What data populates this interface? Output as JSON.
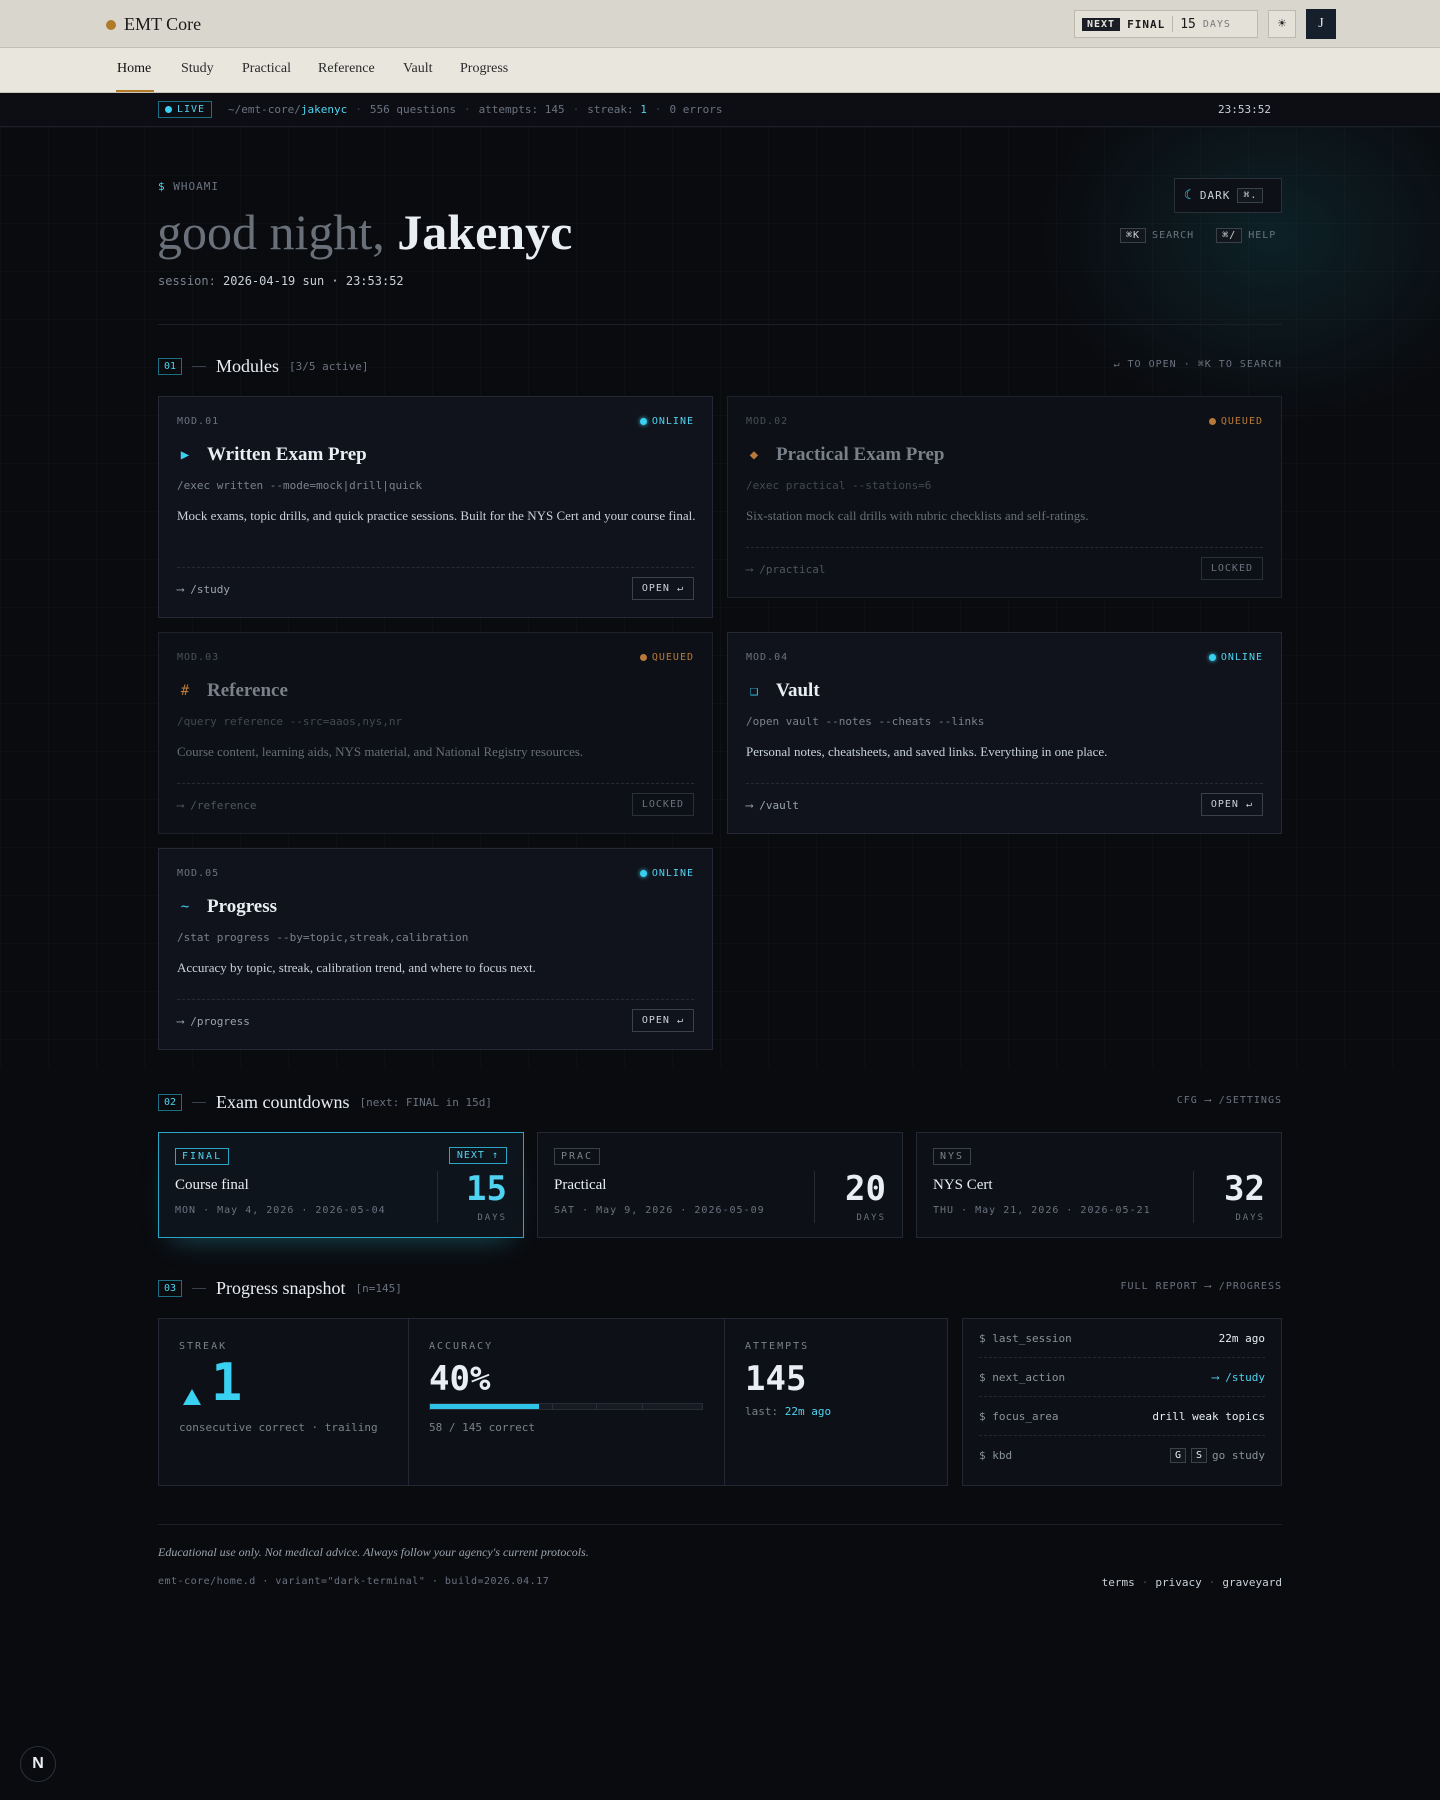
{
  "brand": {
    "name": "EMT Core"
  },
  "topbar": {
    "next_tag": "NEXT",
    "next_label": "FINAL",
    "next_days": "15",
    "next_unit": "DAYS",
    "theme_icon": "sun-icon",
    "avatar_initial": "J"
  },
  "nav": {
    "items": [
      {
        "label": "Home",
        "active": true
      },
      {
        "label": "Study"
      },
      {
        "label": "Practical"
      },
      {
        "label": "Reference"
      },
      {
        "label": "Vault"
      },
      {
        "label": "Progress"
      }
    ]
  },
  "status": {
    "live": "LIVE",
    "path_prefix": "~/emt-core/",
    "user": "jakenyc",
    "questions": "556 questions",
    "attempts": "attempts: 145",
    "streak_label": "streak: ",
    "streak_value": "1",
    "errors": "0 errors",
    "time": "23:53:52"
  },
  "hero": {
    "prompt_symbol": "$",
    "prompt": "WHOAMI",
    "greeting": "good night, ",
    "name": "Jakenyc",
    "session_label": "session: ",
    "session_value": "2026-04-19 sun · 23:53:52",
    "dark_label": "DARK",
    "dark_kbd": "⌘.",
    "search_kbd": "⌘K",
    "search_label": "SEARCH",
    "help_kbd": "⌘/",
    "help_label": "HELP"
  },
  "modules_section": {
    "num": "01",
    "title": "Modules",
    "meta": "[3/5 active]",
    "right": "↵ TO OPEN · ⌘K TO SEARCH",
    "cards": [
      {
        "id": "MOD.01",
        "state": "ONLINE",
        "icon": "▶",
        "title": "Written Exam Prep",
        "cmd": "/exec written --mode=mock|drill|quick",
        "desc": "Mock exams, topic drills, and quick practice sessions. Built for the NYS Cert and your course final.",
        "route": "⟶ /study",
        "action": "OPEN ↵"
      },
      {
        "id": "MOD.02",
        "state": "QUEUED",
        "icon": "◆",
        "title": "Practical Exam Prep",
        "cmd": "/exec practical --stations=6",
        "desc": "Six-station mock call drills with rubric checklists and self-ratings.",
        "route": "⟶ /practical",
        "action": "LOCKED"
      },
      {
        "id": "MOD.03",
        "state": "QUEUED",
        "icon": "#",
        "title": "Reference",
        "cmd": "/query reference --src=aaos,nys,nr",
        "desc": "Course content, learning aids, NYS material, and National Registry resources.",
        "route": "⟶ /reference",
        "action": "LOCKED"
      },
      {
        "id": "MOD.04",
        "state": "ONLINE",
        "icon": "❑",
        "title": "Vault",
        "cmd": "/open vault --notes --cheats --links",
        "desc": "Personal notes, cheatsheets, and saved links. Everything in one place.",
        "route": "⟶ /vault",
        "action": "OPEN ↵"
      },
      {
        "id": "MOD.05",
        "state": "ONLINE",
        "icon": "~",
        "title": "Progress",
        "cmd": "/stat progress --by=topic,streak,calibration",
        "desc": "Accuracy by topic, streak, calibration trend, and where to focus next.",
        "route": "⟶ /progress",
        "action": "OPEN ↵"
      }
    ]
  },
  "countdown_section": {
    "num": "02",
    "title": "Exam countdowns",
    "meta": "[next: FINAL in 15d]",
    "right": "CFG ⟶ /SETTINGS",
    "cards": [
      {
        "tag": "FINAL",
        "badge": "NEXT ↑",
        "name": "Course final",
        "date": "MON · May 4, 2026 · 2026-05-04",
        "days": "15",
        "unit": "DAYS"
      },
      {
        "tag": "PRAC",
        "name": "Practical",
        "date": "SAT · May 9, 2026 · 2026-05-09",
        "days": "20",
        "unit": "DAYS"
      },
      {
        "tag": "NYS",
        "name": "NYS Cert",
        "date": "THU · May 21, 2026 · 2026-05-21",
        "days": "32",
        "unit": "DAYS"
      }
    ]
  },
  "progress_section": {
    "num": "03",
    "title": "Progress snapshot",
    "meta": "[n=145]",
    "right": "FULL REPORT ⟶ /PROGRESS",
    "streak": {
      "label": "STREAK",
      "value": "1",
      "sub": "consecutive correct · trailing"
    },
    "accuracy": {
      "label": "ACCURACY",
      "value": "40%",
      "fraction": 0.4,
      "sub": "58 / 145 correct"
    },
    "attempts": {
      "label": "ATTEMPTS",
      "value": "145",
      "sub_label": "last: ",
      "sub_value": "22m ago"
    },
    "kv": [
      {
        "key": "$ last_session",
        "value": "22m ago"
      },
      {
        "key": "$ next_action",
        "value": "⟶ /study"
      },
      {
        "key": "$ focus_area",
        "value": "drill weak topics"
      },
      {
        "key": "$ kbd",
        "k1": "G",
        "k2": "S",
        "value": "go study"
      }
    ]
  },
  "footer": {
    "disclaimer": "Educational use only. Not medical advice. Always follow your agency's current protocols.",
    "build": "emt-core/home.d · variant=\"dark-terminal\" · build=2026.04.17",
    "links": [
      "terms",
      "privacy",
      "graveyard"
    ],
    "corner_badge": "N"
  },
  "colors": {
    "accent": "#3ad0f2",
    "queued": "#b8793a",
    "brand": "#b07a2a"
  }
}
